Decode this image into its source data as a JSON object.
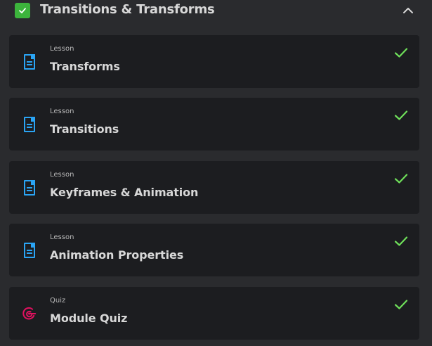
{
  "section": {
    "title": "Transitions & Transforms",
    "completed": true,
    "expanded": true,
    "check_color": "#3cb43c"
  },
  "items": [
    {
      "type": "Lesson",
      "title": "Transforms",
      "icon": "document-icon",
      "completed": true
    },
    {
      "type": "Lesson",
      "title": "Transitions",
      "icon": "document-icon",
      "completed": true
    },
    {
      "type": "Lesson",
      "title": "Keyframes & Animation",
      "icon": "document-icon",
      "completed": true
    },
    {
      "type": "Lesson",
      "title": "Animation Properties",
      "icon": "document-icon",
      "completed": true
    },
    {
      "type": "Quiz",
      "title": "Module Quiz",
      "icon": "target-icon",
      "completed": true
    }
  ],
  "colors": {
    "background": "#2a2b2e",
    "card": "#1c1d20",
    "lesson_icon": "#2aa4f4",
    "quiz_icon": "#e0115f",
    "completed_check": "#6fe05a"
  }
}
